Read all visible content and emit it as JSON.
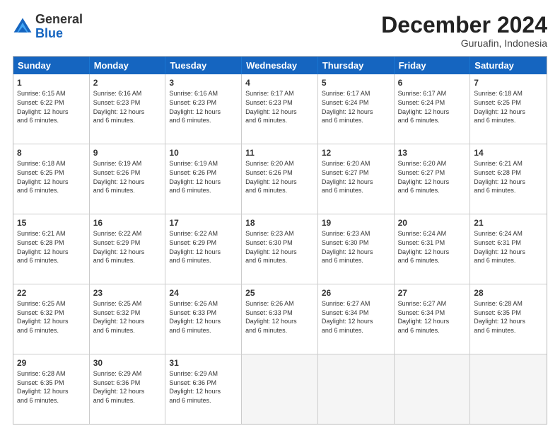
{
  "logo": {
    "general": "General",
    "blue": "Blue"
  },
  "title": "December 2024",
  "subtitle": "Guruafin, Indonesia",
  "days": [
    "Sunday",
    "Monday",
    "Tuesday",
    "Wednesday",
    "Thursday",
    "Friday",
    "Saturday"
  ],
  "weeks": [
    [
      {
        "day": "1",
        "sunrise": "Sunrise: 6:15 AM",
        "sunset": "Sunset: 6:22 PM",
        "daylight": "Daylight: 12 hours and 6 minutes."
      },
      {
        "day": "2",
        "sunrise": "Sunrise: 6:16 AM",
        "sunset": "Sunset: 6:23 PM",
        "daylight": "Daylight: 12 hours and 6 minutes."
      },
      {
        "day": "3",
        "sunrise": "Sunrise: 6:16 AM",
        "sunset": "Sunset: 6:23 PM",
        "daylight": "Daylight: 12 hours and 6 minutes."
      },
      {
        "day": "4",
        "sunrise": "Sunrise: 6:17 AM",
        "sunset": "Sunset: 6:23 PM",
        "daylight": "Daylight: 12 hours and 6 minutes."
      },
      {
        "day": "5",
        "sunrise": "Sunrise: 6:17 AM",
        "sunset": "Sunset: 6:24 PM",
        "daylight": "Daylight: 12 hours and 6 minutes."
      },
      {
        "day": "6",
        "sunrise": "Sunrise: 6:17 AM",
        "sunset": "Sunset: 6:24 PM",
        "daylight": "Daylight: 12 hours and 6 minutes."
      },
      {
        "day": "7",
        "sunrise": "Sunrise: 6:18 AM",
        "sunset": "Sunset: 6:25 PM",
        "daylight": "Daylight: 12 hours and 6 minutes."
      }
    ],
    [
      {
        "day": "8",
        "sunrise": "Sunrise: 6:18 AM",
        "sunset": "Sunset: 6:25 PM",
        "daylight": "Daylight: 12 hours and 6 minutes."
      },
      {
        "day": "9",
        "sunrise": "Sunrise: 6:19 AM",
        "sunset": "Sunset: 6:26 PM",
        "daylight": "Daylight: 12 hours and 6 minutes."
      },
      {
        "day": "10",
        "sunrise": "Sunrise: 6:19 AM",
        "sunset": "Sunset: 6:26 PM",
        "daylight": "Daylight: 12 hours and 6 minutes."
      },
      {
        "day": "11",
        "sunrise": "Sunrise: 6:20 AM",
        "sunset": "Sunset: 6:26 PM",
        "daylight": "Daylight: 12 hours and 6 minutes."
      },
      {
        "day": "12",
        "sunrise": "Sunrise: 6:20 AM",
        "sunset": "Sunset: 6:27 PM",
        "daylight": "Daylight: 12 hours and 6 minutes."
      },
      {
        "day": "13",
        "sunrise": "Sunrise: 6:20 AM",
        "sunset": "Sunset: 6:27 PM",
        "daylight": "Daylight: 12 hours and 6 minutes."
      },
      {
        "day": "14",
        "sunrise": "Sunrise: 6:21 AM",
        "sunset": "Sunset: 6:28 PM",
        "daylight": "Daylight: 12 hours and 6 minutes."
      }
    ],
    [
      {
        "day": "15",
        "sunrise": "Sunrise: 6:21 AM",
        "sunset": "Sunset: 6:28 PM",
        "daylight": "Daylight: 12 hours and 6 minutes."
      },
      {
        "day": "16",
        "sunrise": "Sunrise: 6:22 AM",
        "sunset": "Sunset: 6:29 PM",
        "daylight": "Daylight: 12 hours and 6 minutes."
      },
      {
        "day": "17",
        "sunrise": "Sunrise: 6:22 AM",
        "sunset": "Sunset: 6:29 PM",
        "daylight": "Daylight: 12 hours and 6 minutes."
      },
      {
        "day": "18",
        "sunrise": "Sunrise: 6:23 AM",
        "sunset": "Sunset: 6:30 PM",
        "daylight": "Daylight: 12 hours and 6 minutes."
      },
      {
        "day": "19",
        "sunrise": "Sunrise: 6:23 AM",
        "sunset": "Sunset: 6:30 PM",
        "daylight": "Daylight: 12 hours and 6 minutes."
      },
      {
        "day": "20",
        "sunrise": "Sunrise: 6:24 AM",
        "sunset": "Sunset: 6:31 PM",
        "daylight": "Daylight: 12 hours and 6 minutes."
      },
      {
        "day": "21",
        "sunrise": "Sunrise: 6:24 AM",
        "sunset": "Sunset: 6:31 PM",
        "daylight": "Daylight: 12 hours and 6 minutes."
      }
    ],
    [
      {
        "day": "22",
        "sunrise": "Sunrise: 6:25 AM",
        "sunset": "Sunset: 6:32 PM",
        "daylight": "Daylight: 12 hours and 6 minutes."
      },
      {
        "day": "23",
        "sunrise": "Sunrise: 6:25 AM",
        "sunset": "Sunset: 6:32 PM",
        "daylight": "Daylight: 12 hours and 6 minutes."
      },
      {
        "day": "24",
        "sunrise": "Sunrise: 6:26 AM",
        "sunset": "Sunset: 6:33 PM",
        "daylight": "Daylight: 12 hours and 6 minutes."
      },
      {
        "day": "25",
        "sunrise": "Sunrise: 6:26 AM",
        "sunset": "Sunset: 6:33 PM",
        "daylight": "Daylight: 12 hours and 6 minutes."
      },
      {
        "day": "26",
        "sunrise": "Sunrise: 6:27 AM",
        "sunset": "Sunset: 6:34 PM",
        "daylight": "Daylight: 12 hours and 6 minutes."
      },
      {
        "day": "27",
        "sunrise": "Sunrise: 6:27 AM",
        "sunset": "Sunset: 6:34 PM",
        "daylight": "Daylight: 12 hours and 6 minutes."
      },
      {
        "day": "28",
        "sunrise": "Sunrise: 6:28 AM",
        "sunset": "Sunset: 6:35 PM",
        "daylight": "Daylight: 12 hours and 6 minutes."
      }
    ],
    [
      {
        "day": "29",
        "sunrise": "Sunrise: 6:28 AM",
        "sunset": "Sunset: 6:35 PM",
        "daylight": "Daylight: 12 hours and 6 minutes."
      },
      {
        "day": "30",
        "sunrise": "Sunrise: 6:29 AM",
        "sunset": "Sunset: 6:36 PM",
        "daylight": "Daylight: 12 hours and 6 minutes."
      },
      {
        "day": "31",
        "sunrise": "Sunrise: 6:29 AM",
        "sunset": "Sunset: 6:36 PM",
        "daylight": "Daylight: 12 hours and 6 minutes."
      },
      null,
      null,
      null,
      null
    ]
  ]
}
